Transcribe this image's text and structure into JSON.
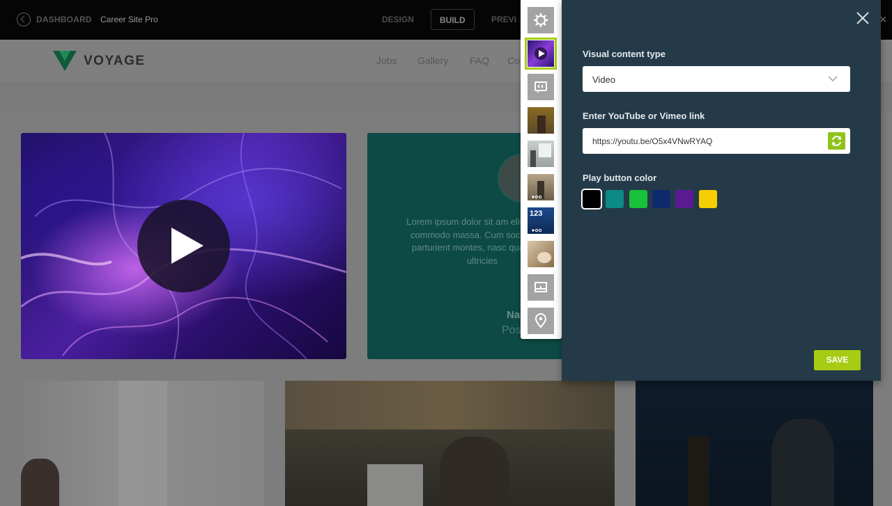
{
  "topbar": {
    "back_label": "DASHBOARD",
    "site_name": "Career Site Pro",
    "tabs": [
      {
        "label": "DESIGN",
        "active": false
      },
      {
        "label": "BUILD",
        "active": true
      },
      {
        "label": "PREVI",
        "active": false
      }
    ]
  },
  "site": {
    "brand": "VOYAGE",
    "nav": [
      "Jobs",
      "Gallery",
      "FAQ",
      "Co"
    ]
  },
  "quote_card": {
    "text": "Lorem ipsum dolor sit am elit. Aenean commodo massa. Cum sociis natoq parturient montes, nasc quam felis, ultricies",
    "name": "Na",
    "position": "Pos"
  },
  "section_bar": {
    "items": [
      {
        "icon": "gear-icon",
        "selected": false
      },
      {
        "icon": "video-thumbnail-icon",
        "selected": true
      },
      {
        "icon": "quote-icon",
        "selected": false
      },
      {
        "icon": "photo-thumbnail-icon",
        "selected": false
      },
      {
        "icon": "presentation-thumbnail-icon",
        "selected": false
      },
      {
        "icon": "gallery-thumbnail-icon",
        "selected": false
      },
      {
        "icon": "stats-thumbnail-icon",
        "selected": false
      },
      {
        "icon": "image-thumbnail-icon",
        "selected": false
      },
      {
        "icon": "layout-icon",
        "selected": false
      },
      {
        "icon": "map-pin-icon",
        "selected": false
      }
    ],
    "stats_text": "123"
  },
  "panel": {
    "content_type_label": "Visual content type",
    "content_type_value": "Video",
    "link_label": "Enter YouTube or Vimeo link",
    "link_value": "https://youtu.be/O5x4VNwRYAQ",
    "play_color_label": "Play button color",
    "colors": [
      "#000000",
      "#0b8a86",
      "#18c23a",
      "#0d2a6c",
      "#5a1a92",
      "#f5cf02"
    ],
    "selected_color": "#000000",
    "save_label": "SAVE"
  }
}
